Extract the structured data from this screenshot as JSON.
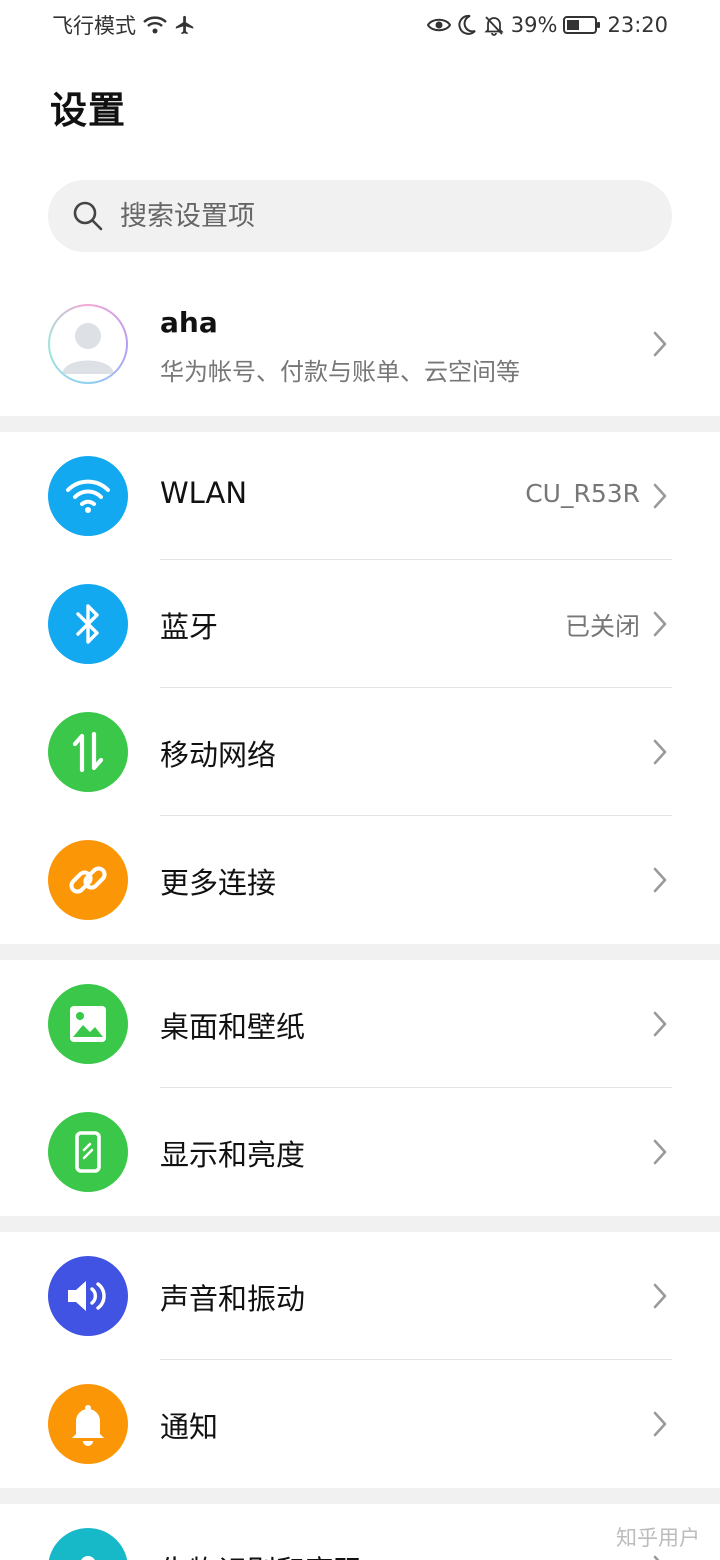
{
  "status_bar": {
    "mode": "飞行模式",
    "battery": "39%",
    "time": "23:20"
  },
  "page": {
    "title": "设置"
  },
  "search": {
    "placeholder": "搜索设置项"
  },
  "account": {
    "name": "aha",
    "subtitle": "华为帐号、付款与账单、云空间等"
  },
  "settings": [
    {
      "label": "WLAN",
      "value": "CU_R53R",
      "icon": "wifi-icon",
      "color": "#12a9f0"
    },
    {
      "label": "蓝牙",
      "value": "已关闭",
      "icon": "bluetooth-icon",
      "color": "#12a9f0"
    },
    {
      "label": "移动网络",
      "value": "",
      "icon": "mobile-network-icon",
      "color": "#3ac74a"
    },
    {
      "label": "更多连接",
      "value": "",
      "icon": "link-icon",
      "color": "#fb9706"
    },
    {
      "label": "桌面和壁纸",
      "value": "",
      "icon": "wallpaper-icon",
      "color": "#3ac74a"
    },
    {
      "label": "显示和亮度",
      "value": "",
      "icon": "display-icon",
      "color": "#3ac74a"
    },
    {
      "label": "声音和振动",
      "value": "",
      "icon": "sound-icon",
      "color": "#4053e2"
    },
    {
      "label": "通知",
      "value": "",
      "icon": "bell-icon",
      "color": "#fb9706"
    },
    {
      "label": "生物识别和密码",
      "value": "",
      "icon": "biometric-icon",
      "color": "#17b8c8"
    }
  ],
  "watermark": "知乎用户"
}
